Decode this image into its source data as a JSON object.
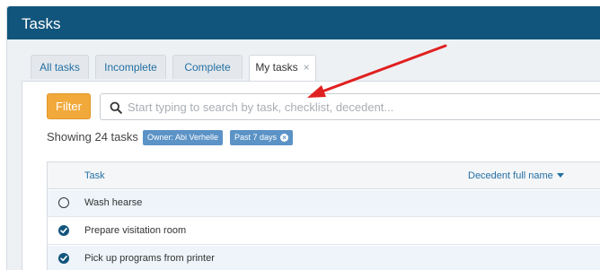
{
  "header": {
    "title": "Tasks"
  },
  "tabs": [
    {
      "label": "All tasks",
      "active": false
    },
    {
      "label": "Incomplete",
      "active": false
    },
    {
      "label": "Complete",
      "active": false
    },
    {
      "label": "My tasks",
      "active": true,
      "close": "×"
    }
  ],
  "toolbar": {
    "filter_label": "Filter",
    "search_placeholder": "Start typing to search by task, checklist, decedent..."
  },
  "summary": {
    "showing": "Showing 24 tasks",
    "chips": [
      {
        "label": "Owner: Abi Verhelle",
        "removable": false
      },
      {
        "label": "Past 7 days",
        "removable": true,
        "close": "×"
      }
    ]
  },
  "table": {
    "columns": {
      "task": "Task",
      "decedent": "Decedent full name"
    },
    "rows": [
      {
        "task": "Wash hearse",
        "completed": false
      },
      {
        "task": "Prepare visitation room",
        "completed": true
      },
      {
        "task": "Pick up programs from printer",
        "completed": true
      }
    ]
  },
  "colors": {
    "header_bg": "#12557c",
    "accent_orange": "#f2a93b",
    "chip_bg": "#5b93c6",
    "link_blue": "#2470a3",
    "annotation_arrow": "#e02020"
  }
}
